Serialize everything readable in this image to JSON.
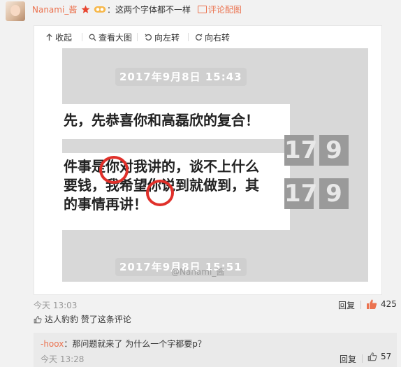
{
  "comment": {
    "username": "Nanami_酱",
    "colon": "：",
    "text": "这两个字体都不一样",
    "pic_link": "评论配图"
  },
  "toolbar": {
    "collapse": "收起",
    "view_large": "查看大图",
    "rotate_left": "向左转",
    "rotate_right": "向右转"
  },
  "photo": {
    "timestamp_top": "2017年9月8日 15:43",
    "bubble_1": "先，先恭喜你和高磊欣的复合！",
    "bubble_2_line_1": "件事是你对我讲的，谈不上什么",
    "bubble_2_line_2": "要钱，我希望你说到就做到，其",
    "bubble_2_line_3": "的事情再讲！",
    "digits_row_1": [
      "17",
      "9"
    ],
    "digits_row_2": [
      "17",
      "9"
    ],
    "timestamp_bottom": "2017年9月8日 15:51",
    "watermark": "@Nanami_酱"
  },
  "meta": {
    "time": "今天 13:03",
    "reply_label": "回复",
    "like_count": "425",
    "liked_by": "达人豹豹 赞了这条评论"
  },
  "sub_reply": {
    "username": "-hoox",
    "colon": "：",
    "text": "那问题就来了 为什么一个字都要p？",
    "time": "今天 13:28",
    "reply_label": "回复",
    "like_count": "57"
  },
  "colors": {
    "accent": "#eb7350",
    "circle": "#e0302a",
    "background": "#f2f2f2"
  }
}
